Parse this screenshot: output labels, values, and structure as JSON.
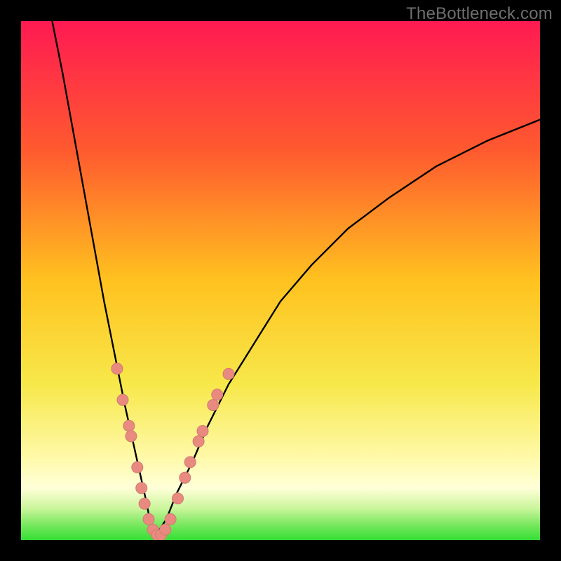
{
  "watermark": {
    "text": "TheBottleneck.com"
  },
  "colors": {
    "frame": "#000000",
    "curve": "#000000",
    "dot_fill": "#e88a80",
    "dot_stroke": "#d4796f",
    "green_band": "#35df35",
    "gradient_stops": [
      {
        "pct": 0,
        "color": "#ff1a52"
      },
      {
        "pct": 25,
        "color": "#ff5a2f"
      },
      {
        "pct": 50,
        "color": "#ffc21f"
      },
      {
        "pct": 70,
        "color": "#f7e84a"
      },
      {
        "pct": 84,
        "color": "#fff9a8"
      },
      {
        "pct": 90,
        "color": "#ffffd8"
      },
      {
        "pct": 94,
        "color": "#c9f59a"
      },
      {
        "pct": 97,
        "color": "#7ae860"
      },
      {
        "pct": 100,
        "color": "#35df35"
      }
    ]
  },
  "chart_data": {
    "type": "line",
    "title": "",
    "xlabel": "",
    "ylabel": "",
    "xlim": [
      0,
      100
    ],
    "ylim": [
      0,
      100
    ],
    "notes": "Bottleneck-style V curve. x is a normalized component-balance axis (0–100); y is bottleneck percentage (0 = no bottleneck at green floor, 100 = top red). Minimum sits near x≈26. Salmon dots mark sampled configurations clustered near the trough.",
    "series": [
      {
        "name": "left-branch",
        "x": [
          6,
          8,
          10,
          12,
          14,
          16,
          18,
          20,
          22,
          24,
          25,
          26
        ],
        "y": [
          100,
          90,
          79,
          68,
          57,
          46,
          36,
          26,
          17,
          8,
          3,
          1
        ]
      },
      {
        "name": "right-branch",
        "x": [
          26,
          28,
          30,
          33,
          36,
          40,
          45,
          50,
          56,
          63,
          71,
          80,
          90,
          100
        ],
        "y": [
          1,
          4,
          9,
          15,
          22,
          30,
          38,
          46,
          53,
          60,
          66,
          72,
          77,
          81
        ]
      }
    ],
    "points": [
      {
        "name": "dot",
        "x": 18.5,
        "y": 33
      },
      {
        "name": "dot",
        "x": 19.6,
        "y": 27
      },
      {
        "name": "dot",
        "x": 20.8,
        "y": 22
      },
      {
        "name": "dot",
        "x": 21.2,
        "y": 20
      },
      {
        "name": "dot",
        "x": 22.4,
        "y": 14
      },
      {
        "name": "dot",
        "x": 23.2,
        "y": 10
      },
      {
        "name": "dot",
        "x": 23.8,
        "y": 7
      },
      {
        "name": "dot",
        "x": 24.6,
        "y": 4
      },
      {
        "name": "dot",
        "x": 25.4,
        "y": 2
      },
      {
        "name": "dot",
        "x": 26.2,
        "y": 1
      },
      {
        "name": "dot",
        "x": 27.0,
        "y": 1
      },
      {
        "name": "dot",
        "x": 27.8,
        "y": 2
      },
      {
        "name": "dot",
        "x": 28.8,
        "y": 4
      },
      {
        "name": "dot",
        "x": 30.2,
        "y": 8
      },
      {
        "name": "dot",
        "x": 31.6,
        "y": 12
      },
      {
        "name": "dot",
        "x": 32.6,
        "y": 15
      },
      {
        "name": "dot",
        "x": 34.2,
        "y": 19
      },
      {
        "name": "dot",
        "x": 35.0,
        "y": 21
      },
      {
        "name": "dot",
        "x": 37.0,
        "y": 26
      },
      {
        "name": "dot",
        "x": 37.8,
        "y": 28
      },
      {
        "name": "dot",
        "x": 40.0,
        "y": 32
      }
    ]
  }
}
